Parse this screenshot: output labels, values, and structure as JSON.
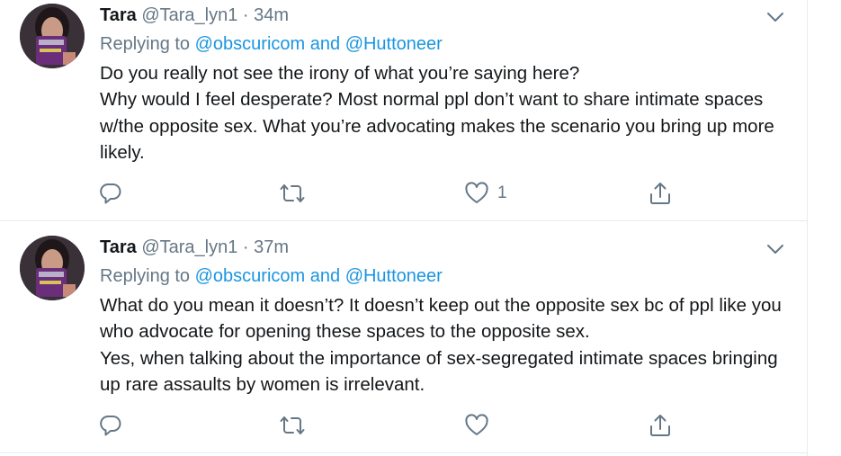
{
  "tweets": [
    {
      "name": "Tara",
      "handle": "@Tara_lyn1",
      "separator": "·",
      "time": "34m",
      "replying_prefix": "Replying to",
      "mention1": "@obscuricom",
      "and_word": "and",
      "mention2": "@Huttoneer",
      "lines": [
        "Do you really not see the irony of what you’re saying here?",
        "Why would I feel desperate? Most normal ppl don’t want to share intimate spaces w/the opposite sex. What you’re advocating makes the scenario you bring up more likely."
      ],
      "like_count": "1",
      "icons": {
        "reply": "reply-icon",
        "retweet": "retweet-icon",
        "like": "heart-icon",
        "share": "share-icon",
        "menu": "chevron-down-icon"
      }
    },
    {
      "name": "Tara",
      "handle": "@Tara_lyn1",
      "separator": "·",
      "time": "37m",
      "replying_prefix": "Replying to",
      "mention1": "@obscuricom",
      "and_word": "and",
      "mention2": "@Huttoneer",
      "lines": [
        "What do you mean it doesn’t? It doesn’t keep out the opposite sex bc of ppl like you who advocate for opening these spaces to the opposite sex.",
        "Yes, when talking about the importance of sex-segregated intimate spaces bringing up rare assaults by women is irrelevant."
      ],
      "like_count": "",
      "icons": {
        "reply": "reply-icon",
        "retweet": "retweet-icon",
        "like": "heart-icon",
        "share": "share-icon",
        "menu": "chevron-down-icon"
      }
    }
  ],
  "colors": {
    "text": "#14171a",
    "secondary": "#657786",
    "link": "#1b95e0",
    "divider": "#e6ecf0"
  }
}
